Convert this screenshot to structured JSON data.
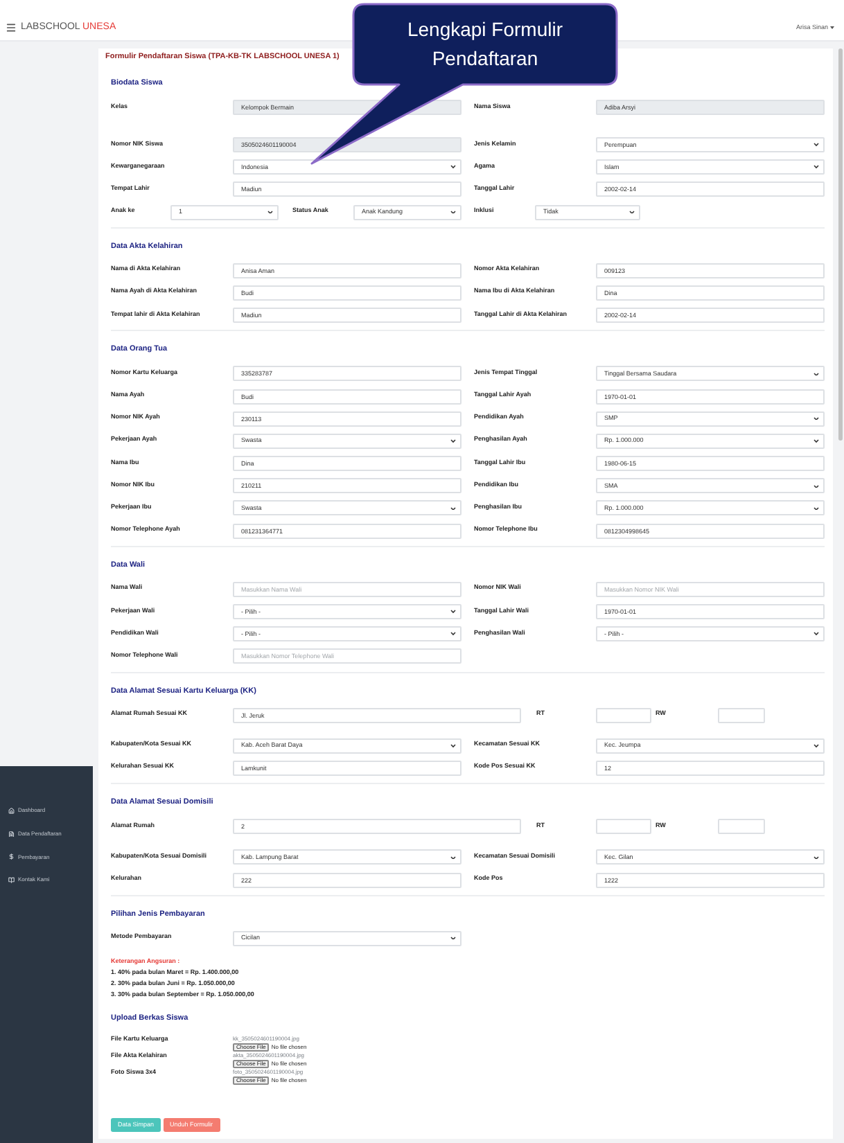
{
  "header": {
    "brand": "LABSCHOOL",
    "brand_accent": "UNESA",
    "user": "Arisa Sinan"
  },
  "sidebar": {
    "items": [
      {
        "label": "Dashboard"
      },
      {
        "label": "Data Pendaftaran"
      },
      {
        "label": "Pembayaran"
      },
      {
        "label": "Kontak Kami"
      }
    ]
  },
  "callout": {
    "text": "Lengkapi Formulir Pendaftaran"
  },
  "form": {
    "title": "Formulir Pendaftaran Siswa (TPA-KB-TK LABSCHOOL UNESA 1)",
    "sections": [
      {
        "title": "Biodata Siswa",
        "rows": [
          {
            "kind": "pair",
            "fields": [
              {
                "label": "Kelas",
                "kind": "input",
                "value": "Kelompok Bermain",
                "disabled": true
              },
              {
                "label": "Nama Siswa",
                "kind": "input",
                "value": "Adiba Arsyi",
                "disabled": true
              }
            ]
          },
          {
            "kind": "pair",
            "fields": [
              {
                "label": "Nomor NIK Siswa",
                "kind": "input",
                "value": "3505024601190004",
                "disabled": true
              },
              {
                "label": "Jenis Kelamin",
                "kind": "select",
                "value": "Perempuan",
                "disabled": false
              }
            ]
          },
          {
            "kind": "pair",
            "fields": [
              {
                "label": "Kewarganegaraan",
                "kind": "select",
                "value": "Indonesia",
                "disabled": false
              },
              {
                "label": "Agama",
                "kind": "select",
                "value": "Islam",
                "disabled": false
              }
            ]
          },
          {
            "kind": "pair",
            "fields": [
              {
                "label": "Tempat Lahir",
                "kind": "input",
                "value": "Madiun",
                "disabled": false
              },
              {
                "label": "Tanggal Lahir",
                "kind": "input",
                "value": "2002-02-14",
                "disabled": false
              }
            ]
          },
          {
            "kind": "triple",
            "fields": [
              {
                "label": "Anak ke",
                "kind": "select",
                "value": "1",
                "disabled": false
              },
              {
                "label": "Status Anak",
                "kind": "select",
                "value": "Anak Kandung",
                "disabled": false
              },
              {
                "label": "Inklusi",
                "kind": "select",
                "value": "Tidak",
                "disabled": false
              }
            ]
          }
        ]
      },
      {
        "title": "Data Akta Kelahiran",
        "rows": [
          {
            "kind": "pair",
            "fields": [
              {
                "label": "Nama di Akta Kelahiran",
                "kind": "input",
                "value": "Anisa Aman"
              },
              {
                "label": "Nomor Akta Kelahiran",
                "kind": "input",
                "value": "009123"
              }
            ]
          },
          {
            "kind": "pair",
            "fields": [
              {
                "label": "Nama Ayah di Akta Kelahiran",
                "kind": "input",
                "value": "Budi"
              },
              {
                "label": "Nama Ibu di Akta Kelahiran",
                "kind": "input",
                "value": "Dina"
              }
            ]
          },
          {
            "kind": "pair",
            "fields": [
              {
                "label": "Tempat lahir di Akta Kelahiran",
                "kind": "input",
                "value": "Madiun"
              },
              {
                "label": "Tanggal Lahir di Akta Kelahiran",
                "kind": "input",
                "value": "2002-02-14"
              }
            ]
          }
        ]
      },
      {
        "title": "Data Orang Tua",
        "rows": [
          {
            "kind": "pair",
            "fields": [
              {
                "label": "Nomor Kartu Keluarga",
                "kind": "input",
                "value": "335283787"
              },
              {
                "label": "Jenis Tempat Tinggal",
                "kind": "select",
                "value": "Tinggal Bersama Saudara"
              }
            ]
          },
          {
            "kind": "pair",
            "fields": [
              {
                "label": "Nama Ayah",
                "kind": "input",
                "value": "Budi"
              },
              {
                "label": "Tanggal Lahir Ayah",
                "kind": "input",
                "value": "1970-01-01"
              }
            ]
          },
          {
            "kind": "pair",
            "fields": [
              {
                "label": "Nomor NIK Ayah",
                "kind": "input",
                "value": "230113"
              },
              {
                "label": "Pendidikan Ayah",
                "kind": "select",
                "value": "SMP"
              }
            ]
          },
          {
            "kind": "pair",
            "fields": [
              {
                "label": "Pekerjaan Ayah",
                "kind": "select",
                "value": "Swasta"
              },
              {
                "label": "Penghasilan Ayah",
                "kind": "select",
                "value": "Rp. 1.000.000"
              }
            ]
          },
          {
            "kind": "pair",
            "fields": [
              {
                "label": "Nama Ibu",
                "kind": "input",
                "value": "Dina"
              },
              {
                "label": "Tanggal Lahir Ibu",
                "kind": "input",
                "value": "1980-06-15"
              }
            ]
          },
          {
            "kind": "pair",
            "fields": [
              {
                "label": "Nomor NIK Ibu",
                "kind": "input",
                "value": "210211"
              },
              {
                "label": "Pendidikan Ibu",
                "kind": "select",
                "value": "SMA"
              }
            ]
          },
          {
            "kind": "pair",
            "fields": [
              {
                "label": "Pekerjaan Ibu",
                "kind": "select",
                "value": "Swasta"
              },
              {
                "label": "Penghasilan Ibu",
                "kind": "select",
                "value": "Rp. 1.000.000"
              }
            ]
          },
          {
            "kind": "pair",
            "fields": [
              {
                "label": "Nomor Telephone Ayah",
                "kind": "input",
                "value": "081231364771"
              },
              {
                "label": "Nomor Telephone Ibu",
                "kind": "input",
                "value": "0812304998645"
              }
            ]
          }
        ]
      },
      {
        "title": "Data Wali",
        "rows": [
          {
            "kind": "pair",
            "fields": [
              {
                "label": "Nama Wali",
                "kind": "input",
                "placeholder": "Masukkan Nama Wali"
              },
              {
                "label": "Nomor NIK Wali",
                "kind": "input",
                "placeholder": "Masukkan Nomor NIK Wali"
              }
            ]
          },
          {
            "kind": "pair",
            "fields": [
              {
                "label": "Pekerjaan Wali",
                "kind": "select",
                "value": "- Pilih -"
              },
              {
                "label": "Tanggal Lahir Wali",
                "kind": "input",
                "value": "1970-01-01"
              }
            ]
          },
          {
            "kind": "pair",
            "fields": [
              {
                "label": "Pendidikan Wali",
                "kind": "select",
                "value": "- Pilih -"
              },
              {
                "label": "Penghasilan Wali",
                "kind": "select",
                "value": "- Pilih -"
              }
            ]
          },
          {
            "kind": "single",
            "fields": [
              {
                "label": "Nomor Telephone Wali",
                "kind": "input",
                "placeholder": "Masukkan Nomor Telephone Wali"
              }
            ]
          }
        ]
      },
      {
        "title": "Data Alamat Sesuai Kartu Keluarga (KK)",
        "rows": [
          {
            "kind": "address",
            "fields": [
              {
                "label": "Alamat Rumah Sesuai KK",
                "kind": "input",
                "value": "Jl. Jeruk"
              },
              {
                "label": "RT",
                "kind": "input"
              },
              {
                "label": "RW",
                "kind": "input"
              }
            ]
          },
          {
            "kind": "pair",
            "fields": [
              {
                "label": "Kabupaten/Kota Sesuai KK",
                "kind": "select",
                "value": "Kab. Aceh Barat Daya"
              },
              {
                "label": "Kecamatan Sesuai KK",
                "kind": "select",
                "value": "Kec. Jeumpa"
              }
            ]
          },
          {
            "kind": "pair",
            "fields": [
              {
                "label": "Kelurahan Sesuai KK",
                "kind": "input",
                "value": "Lamkunit"
              },
              {
                "label": "Kode Pos Sesuai KK",
                "kind": "input",
                "value": "12"
              }
            ]
          }
        ]
      },
      {
        "title": "Data Alamat Sesuai Domisili",
        "rows": [
          {
            "kind": "address",
            "fields": [
              {
                "label": "Alamat Rumah",
                "kind": "input",
                "value": "2"
              },
              {
                "label": "RT",
                "kind": "input"
              },
              {
                "label": "RW",
                "kind": "input"
              }
            ]
          },
          {
            "kind": "pair",
            "fields": [
              {
                "label": "Kabupaten/Kota Sesuai Domisili",
                "kind": "select",
                "value": "Kab. Lampung Barat"
              },
              {
                "label": "Kecamatan Sesuai Domisili",
                "kind": "select",
                "value": "Kec. Gilan"
              }
            ]
          },
          {
            "kind": "pair",
            "fields": [
              {
                "label": "Kelurahan",
                "kind": "input",
                "value": "222"
              },
              {
                "label": "Kode Pos",
                "kind": "input",
                "value": "1222"
              }
            ]
          }
        ]
      },
      {
        "title": "Pilihan Jenis Pembayaran",
        "rows": [
          {
            "kind": "single",
            "fields": [
              {
                "label": "Metode Pembayaran",
                "kind": "select",
                "value": "Cicilan"
              }
            ]
          }
        ],
        "note": {
          "title": "Keterangan Angsuran :",
          "lines": [
            "1. 40% pada bulan Maret = Rp. 1.400.000,00",
            "2. 30% pada bulan Juni = Rp. 1.050.000,00",
            "3. 30% pada bulan September = Rp. 1.050.000,00"
          ]
        }
      },
      {
        "title": "Upload Berkas Siswa",
        "uploads": [
          {
            "label": "File Kartu Keluarga",
            "current": "kk_3505024601190004.jpg",
            "button": "Choose File",
            "status": "No file chosen"
          },
          {
            "label": "File Akta Kelahiran",
            "current": "akta_3505024601190004.jpg",
            "button": "Choose File",
            "status": "No file chosen"
          },
          {
            "label": "Foto Siswa 3x4",
            "current": "foto_3505024601190004.jpg",
            "button": "Choose File",
            "status": "No file chosen"
          }
        ]
      }
    ],
    "buttons": [
      {
        "label": "Data Simpan",
        "kind": "save"
      },
      {
        "label": "Unduh Formulir",
        "kind": "download"
      }
    ]
  }
}
